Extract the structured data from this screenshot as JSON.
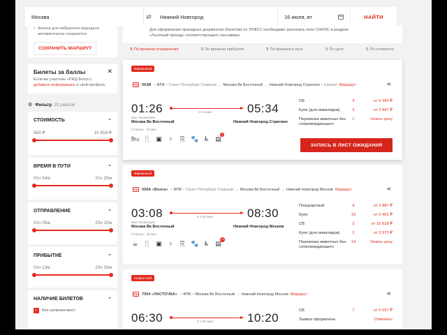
{
  "search": {
    "from": "Москва",
    "to": "Нижний Новгород",
    "date": "16 июля, вт",
    "find_label": "НАЙТИ"
  },
  "sidebar": {
    "route_note": "Фильтр для избранного маршрута автоматически сохранится.",
    "save_route_label": "СОХРАНИТЬ МАРШРУТ",
    "bonus_title": "Билеты за баллы",
    "bonus_text_1": "Если вы участник «РЖД Бонус»,",
    "bonus_link": "добавьте информацию",
    "bonus_text_2": "в свой профиль",
    "filter_label": "Фильтр",
    "filter_count": "20 рейсов",
    "filters": [
      {
        "title": "СТОИМОСТЬ",
        "min": "682 ₽",
        "max": "10 818 ₽"
      },
      {
        "title": "ВРЕМЯ В ПУТИ",
        "min": "01ч 54м",
        "max": "21ч 25м"
      },
      {
        "title": "ОТПРАВЛЕНИЕ",
        "min": "01ч 05м",
        "max": "23ч 10м"
      },
      {
        "title": "ПРИБЫТИЕ",
        "min": "01ч 13м",
        "max": "23ч 16м"
      },
      {
        "title": "НАЛИЧИЕ БИЛЕТОВ",
        "checkbox": "Без наличия мест"
      }
    ]
  },
  "info": {
    "line1": "Для оформления проездных документов (билетов) по ЭТФСС необходимо заполнить поле СНИЛС в разделе",
    "line2": "«Льготный проезд» соответствующего пассажира."
  },
  "sort": [
    "По времени отправления",
    "По времени прибытия",
    "По времени в пути",
    "По цене",
    "По стоимости"
  ],
  "trains": [
    {
      "badge": "Фирменный",
      "number": "063В",
      "carrier": "ФПК",
      "route_from": "Санкт-Петербург-Главный",
      "route_via": "Москва Вк Восточный",
      "route_to": "Нижний Новгород Стригино",
      "extra": "Связан",
      "extra_link": "Маршрут",
      "dep": "01:26",
      "arr": "05:34",
      "duration": "4ч 8 мин",
      "dep_note": "Мск Посмотрим",
      "dep_station": "Москва Вк Восточный",
      "arr_station": "Нижний Новгород Стригино",
      "stop_note": "Стоянка : 12 мин",
      "amenity_badge": "3",
      "prices": [
        {
          "name": "СВ",
          "count": "9",
          "price": "от 9 350 ₽"
        },
        {
          "name": "Купе (для инвалидов)",
          "count": "2",
          "price": "от 2 847 ₽"
        },
        {
          "name": "Перевозка животных без сопровождающего",
          "count": "0",
          "price": "Узнать цену"
        }
      ],
      "button": "ЗАПИСЬ В ЛИСТ ОЖИДАНИЯ"
    },
    {
      "badge": "Фирменный",
      "number": "059А «Волга»",
      "carrier": "ФПК",
      "route_from": "Санкт-Петербург-Главный",
      "route_via": "Москва Вк Восточный",
      "route_to": "Нижний Новгород Москов",
      "extra": "",
      "extra_link": "Маршрут",
      "dep": "03:08",
      "arr": "08:30",
      "duration": "5 ч 22 мин",
      "dep_note": "Мск Посмотрим",
      "dep_station": "Москва Вк Восточный",
      "arr_station": "Нижний Новгород Москов",
      "stop_note": "Стоянка : 15 мин",
      "amenity_badge": "13",
      "prices": [
        {
          "name": "Плацкартный",
          "count": "4",
          "price": "от 2 887 ₽"
        },
        {
          "name": "Купе",
          "count": "19",
          "price": "от 5 401 ₽"
        },
        {
          "name": "СВ",
          "count": "2",
          "price": "от 10 818 ₽"
        },
        {
          "name": "Купе (для инвалидов)",
          "count": "2",
          "price": "от 2 973 ₽"
        },
        {
          "name": "Перевозка животных без сопровождающего",
          "count": "14",
          "price": "Узнать цену"
        }
      ]
    },
    {
      "badge": "Скоростной",
      "number": "7054 «ЛАСТОЧКА»",
      "carrier": "ФПК",
      "route_from": "Москва Вк Восточный",
      "route_via": "",
      "route_to": "Нижний Новгород Москов",
      "extra": "",
      "extra_link": "Маршрут",
      "dep": "06:30",
      "arr": "10:20",
      "duration": "3 ч 50 мин",
      "prices": [
        {
          "name": "СВ",
          "count": "7",
          "price": "от 5 557 ₽"
        },
        {
          "name": "Заявка оформлена",
          "count": "",
          "price": "Отменить"
        }
      ]
    }
  ]
}
